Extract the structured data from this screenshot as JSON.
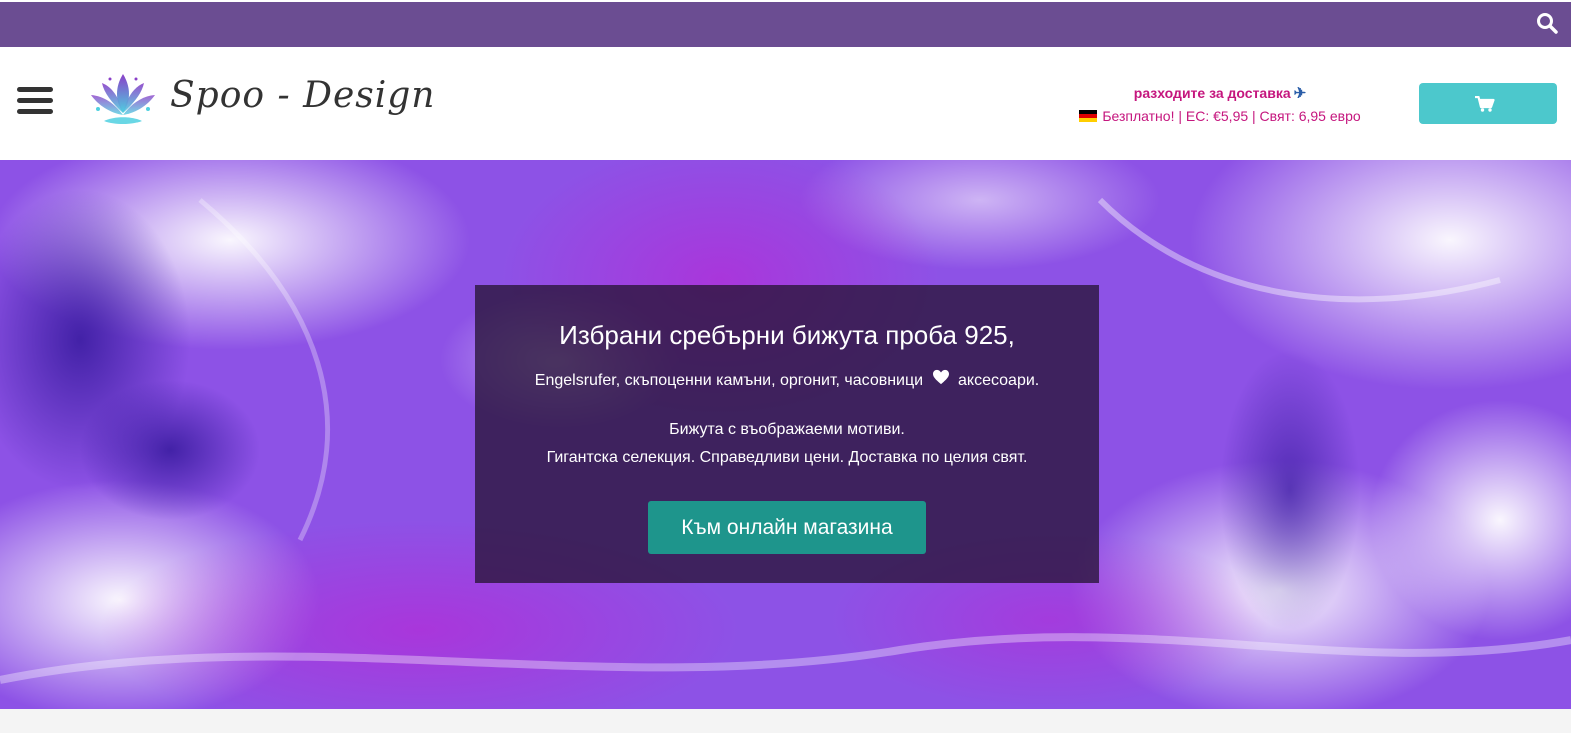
{
  "topbar": {
    "icon": "search-icon",
    "color": "#6b4d92"
  },
  "header": {
    "menu_icon": "hamburger-menu-icon",
    "logo_icon": "lotus-logo-icon",
    "brand": "Spoo - Design",
    "shipping": {
      "title": "разходите за доставка",
      "title_icon": "airplane-icon",
      "details": "Безплатно! | ЕС: €5,95 | Свят: 6,95 евро",
      "flag_icon": "germany-flag-icon",
      "color": "#c5167e"
    },
    "cart_icon": "shopping-cart-icon",
    "cart_color": "#4cc8cc"
  },
  "hero": {
    "heading": "Избрани сребърни бижута проба 925,",
    "line1_before": "Engelsrufer, скъпоценни камъни, оргонит, часовници",
    "line1_icon": "heart-icon",
    "line1_after": "аксесоари.",
    "line2": "Бижута с въображаеми мотиви.",
    "line3": "Гигантска селекция. Справедливи цени. Доставка по целия свят.",
    "button": "Към онлайн магазина",
    "button_color": "#1e958c"
  }
}
